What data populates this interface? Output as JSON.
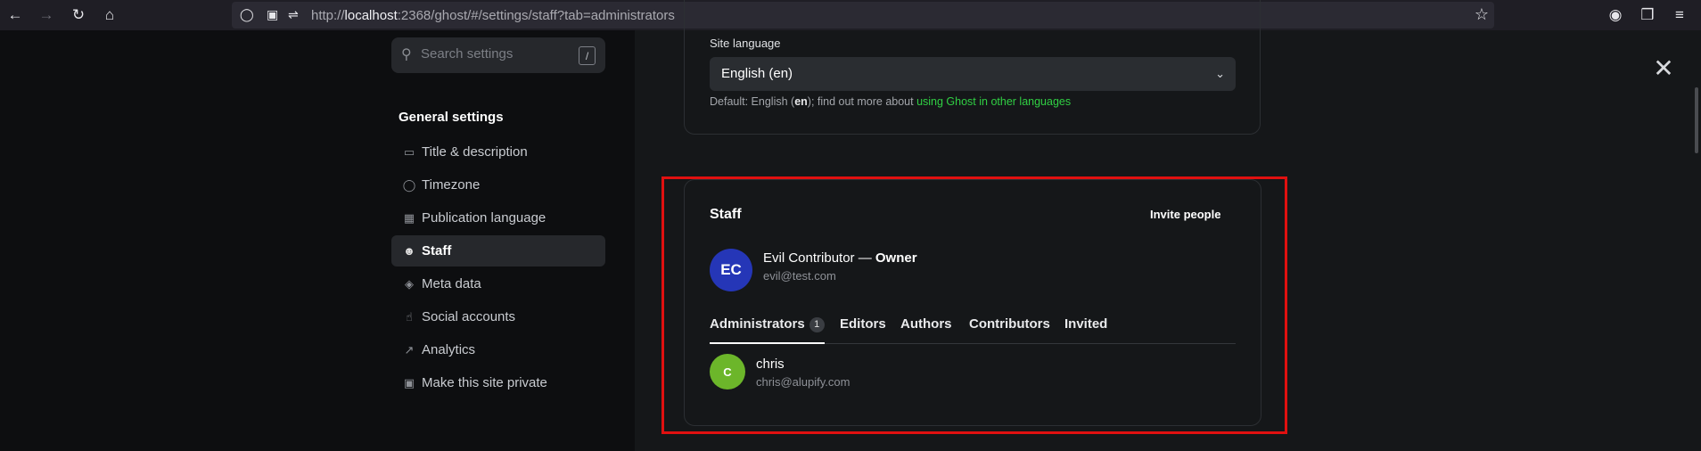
{
  "browser": {
    "url_protocol": "http://",
    "url_host": "localhost",
    "url_rest": ":2368/ghost/#/settings/staff?tab=administrators"
  },
  "sidebar": {
    "search_placeholder": "Search settings",
    "search_shortcut": "/",
    "section_title": "General settings",
    "items": [
      {
        "label": "Title & description",
        "icon": "title-icon"
      },
      {
        "label": "Timezone",
        "icon": "globe-icon"
      },
      {
        "label": "Publication language",
        "icon": "language-icon"
      },
      {
        "label": "Staff",
        "icon": "staff-icon",
        "active": true
      },
      {
        "label": "Meta data",
        "icon": "layers-icon"
      },
      {
        "label": "Social accounts",
        "icon": "thumbs-up-icon"
      },
      {
        "label": "Analytics",
        "icon": "chart-icon"
      },
      {
        "label": "Make this site private",
        "icon": "lock-icon"
      }
    ]
  },
  "language": {
    "label": "Site language",
    "value": "English (en)",
    "help_prefix": "Default: English (",
    "help_code": "en",
    "help_mid": "); find out more about ",
    "help_link": "using Ghost in other languages"
  },
  "staff": {
    "title": "Staff",
    "invite_label": "Invite people",
    "owner": {
      "initials": "EC",
      "name": "Evil Contributor",
      "separator": " — ",
      "role": "Owner",
      "email": "evil@test.com",
      "color": "#2536b7"
    },
    "tabs": [
      {
        "label": "Administrators",
        "count": "1"
      },
      {
        "label": "Editors"
      },
      {
        "label": "Authors"
      },
      {
        "label": "Contributors"
      },
      {
        "label": "Invited"
      }
    ],
    "users": [
      {
        "initial": "C",
        "name": "chris",
        "email": "chris@alupify.com",
        "color": "#6cb62a"
      }
    ]
  },
  "colors": {
    "highlight": "#e01010",
    "link": "#30cf43"
  }
}
